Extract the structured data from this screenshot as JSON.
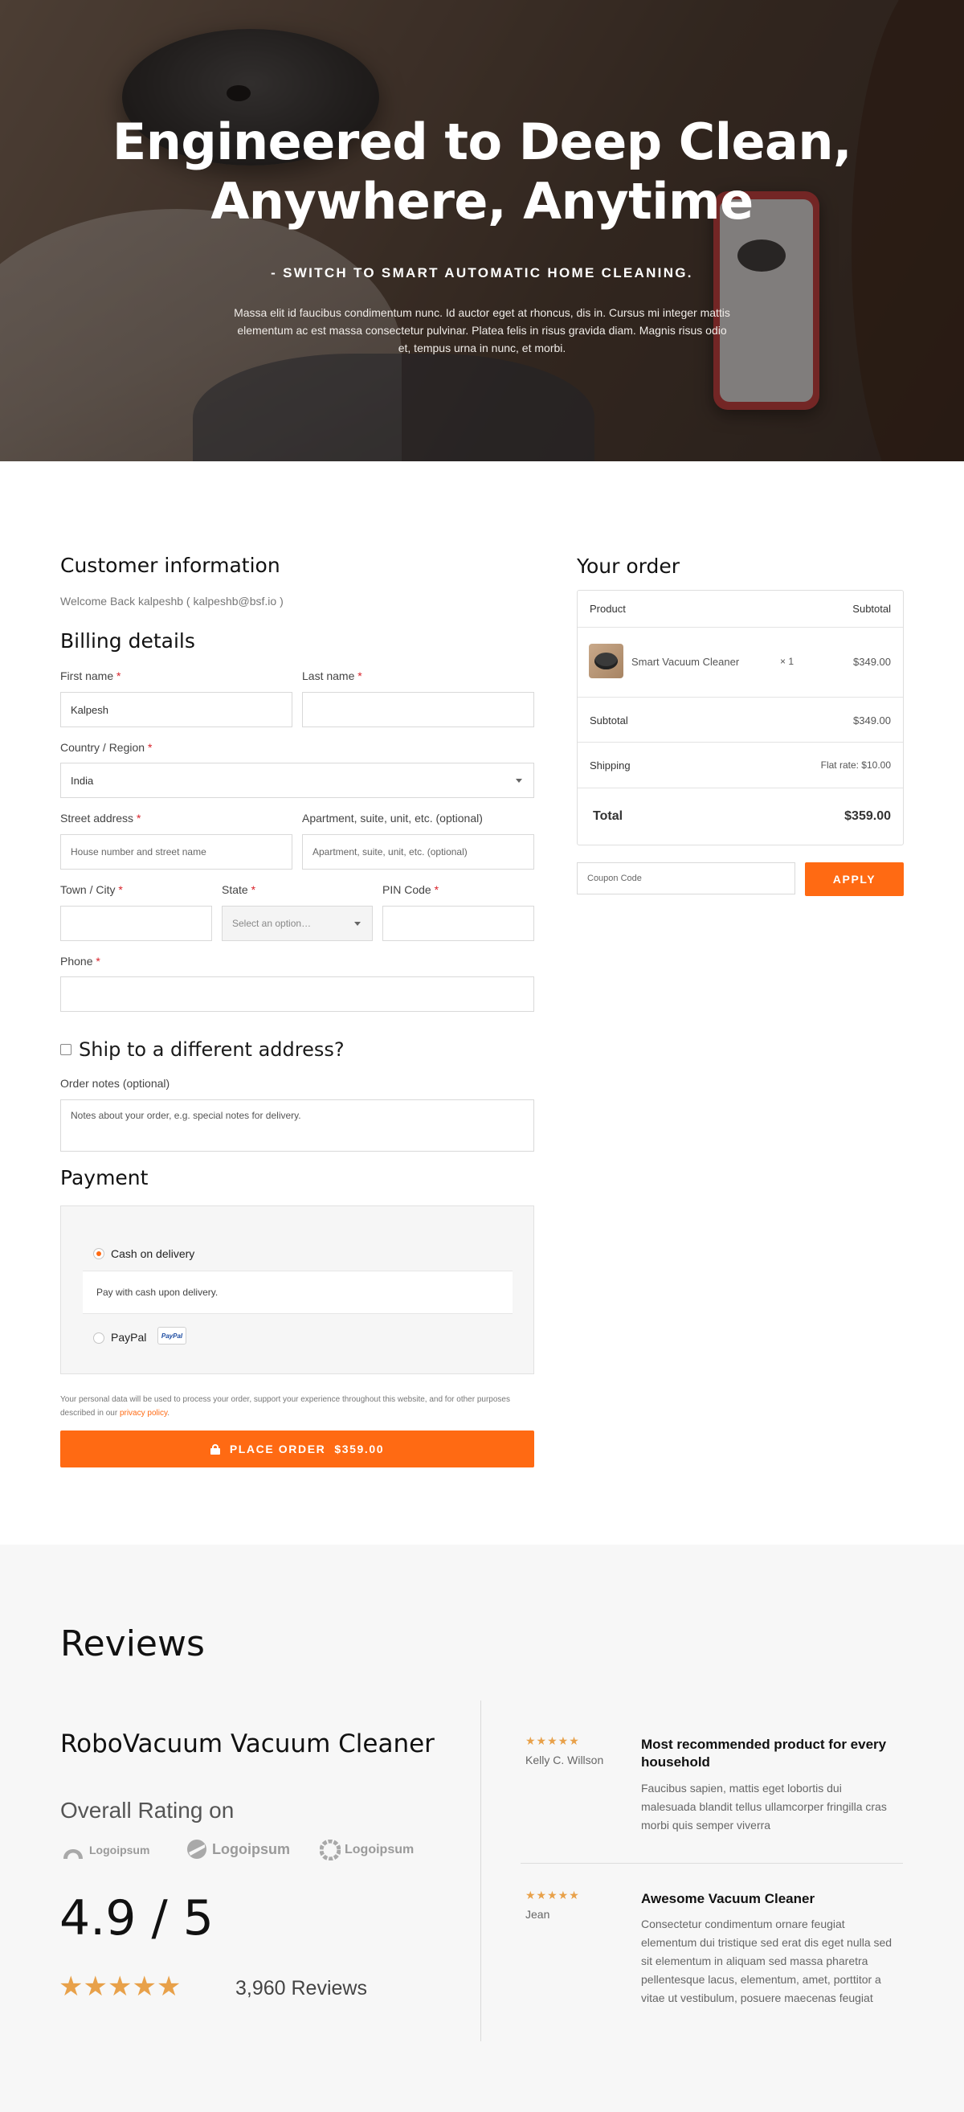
{
  "hero": {
    "title_line1": "Engineered to Deep Clean,",
    "title_line2": "Anywhere, Anytime",
    "subtitle": "- SWITCH TO SMART AUTOMATIC HOME CLEANING.",
    "description": "Massa elit id faucibus condimentum nunc. Id auctor eget at rhoncus, dis in. Cursus mi integer mattis elementum ac est massa consectetur pulvinar. Platea felis in risus gravida diam. Magnis risus odio et, tempus urna in nunc, et morbi."
  },
  "customer": {
    "heading": "Customer information",
    "welcome": "Welcome Back kalpeshb ( kalpeshb@bsf.io )"
  },
  "billing": {
    "heading": "Billing details",
    "required_mark": "*",
    "first_name_label": "First name",
    "first_name_value": "Kalpesh",
    "last_name_label": "Last name",
    "last_name_value": "",
    "country_label": "Country / Region",
    "country_value": "India",
    "street_label": "Street address",
    "street_placeholder": "House number and street name",
    "apartment_label": "Apartment, suite, unit, etc. (optional)",
    "apartment_placeholder": "Apartment, suite, unit, etc. (optional)",
    "city_label": "Town / City",
    "state_label": "State",
    "state_placeholder": "Select an option…",
    "pin_label": "PIN Code",
    "phone_label": "Phone"
  },
  "shipping": {
    "ship_different_label": "Ship to a different address?",
    "order_notes_label": "Order notes (optional)",
    "order_notes_placeholder": "Notes about your order, e.g. special notes for delivery."
  },
  "payment": {
    "heading": "Payment",
    "cod_label": "Cash on delivery",
    "cod_description": "Pay with cash upon delivery.",
    "paypal_label": "PayPal",
    "paypal_badge": "PayPal",
    "privacy_text": "Your personal data will be used to process your order, support your experience throughout this website, and for other purposes described in our",
    "privacy_link": "privacy policy",
    "privacy_end": ".",
    "place_order_label": "PLACE ORDER",
    "place_order_amount": "$359.00"
  },
  "order": {
    "heading": "Your order",
    "col_product": "Product",
    "col_subtotal": "Subtotal",
    "item_name": "Smart Vacuum Cleaner",
    "item_qty": "× 1",
    "item_price": "$349.00",
    "subtotal_label": "Subtotal",
    "subtotal_value": "$349.00",
    "shipping_label": "Shipping",
    "shipping_value": "Flat rate: $10.00",
    "total_label": "Total",
    "total_value": "$359.00",
    "coupon_placeholder": "Coupon Code",
    "apply_label": "APPLY"
  },
  "reviews": {
    "heading": "Reviews",
    "product_name": "RoboVacuum Vacuum Cleaner",
    "overall_label": "Overall Rating on",
    "logos": [
      "Logoipsum",
      "Logoipsum",
      "Logoipsum"
    ],
    "rating": "4.9 / 5",
    "rating_stars": "★★★★★",
    "review_count": "3,960 Reviews",
    "items": [
      {
        "stars": "★★★★★",
        "author": "Kelly C. Willson",
        "title": "Most recommended product for every household",
        "body": "Faucibus sapien, mattis eget lobortis dui malesuada blandit tellus ullamcorper fringilla cras morbi quis semper viverra"
      },
      {
        "stars": "★★★★★",
        "author": "Jean",
        "title": "Awesome Vacuum Cleaner",
        "body": "Consectetur condimentum ornare feugiat elementum dui tristique sed erat dis eget nulla sed sit elementum in aliquam sed massa pharetra pellentesque lacus, elementum, amet, porttitor a vitae ut vestibulum, posuere maecenas feugiat"
      }
    ]
  },
  "colors": {
    "accent": "#ff6a13",
    "star": "#e8a14a",
    "required": "#d9222a"
  }
}
